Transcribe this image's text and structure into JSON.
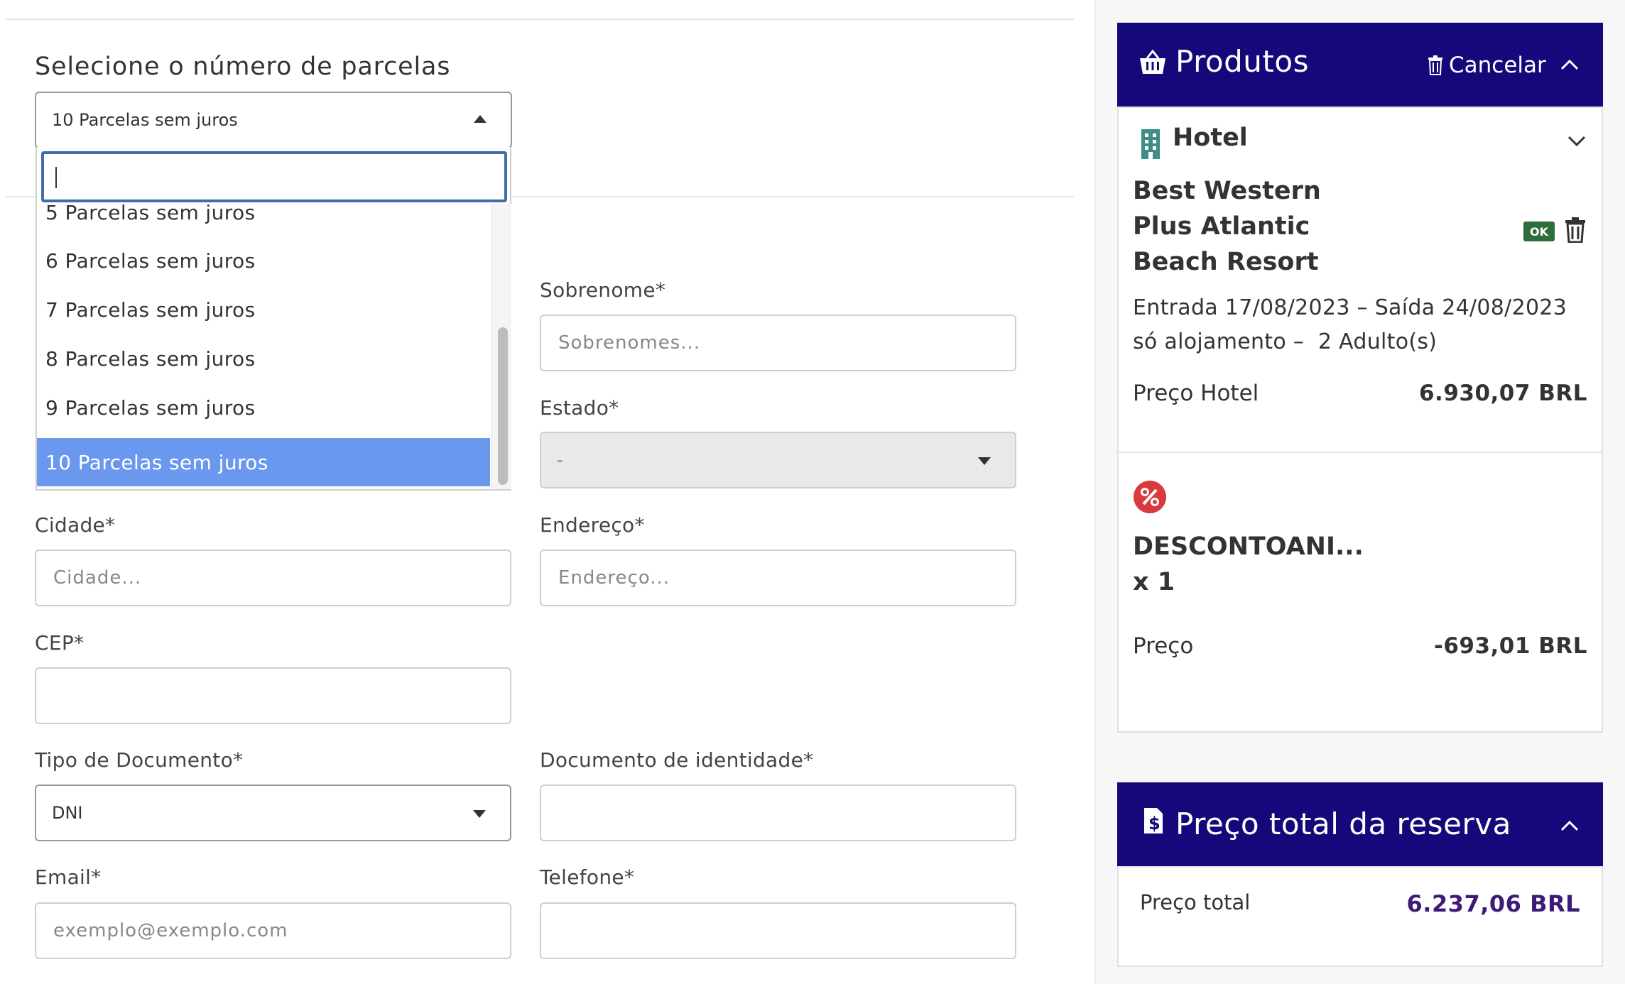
{
  "installments": {
    "label": "Selecione o número de parcelas",
    "selected": "10 Parcelas sem juros",
    "search_value": "",
    "options": [
      "5 Parcelas sem juros",
      "6 Parcelas sem juros",
      "7 Parcelas sem juros",
      "8 Parcelas sem juros",
      "9 Parcelas sem juros",
      "10 Parcelas sem juros"
    ]
  },
  "form": {
    "sobrenome": {
      "label": "Sobrenome*",
      "placeholder": "Sobrenomes..."
    },
    "estado": {
      "label": "Estado*",
      "value": "-"
    },
    "cidade": {
      "label": "Cidade*",
      "placeholder": "Cidade..."
    },
    "endereco": {
      "label": "Endereço*",
      "placeholder": "Endereço..."
    },
    "cep": {
      "label": "CEP*",
      "placeholder": ""
    },
    "tipo_documento": {
      "label": "Tipo de Documento*",
      "value": "DNI"
    },
    "documento": {
      "label": "Documento de identidade*",
      "placeholder": ""
    },
    "email": {
      "label": "Email*",
      "placeholder": "exemplo@exemplo.com"
    },
    "telefone": {
      "label": "Telefone*",
      "placeholder": ""
    }
  },
  "products": {
    "title": "Produtos",
    "cancel": "Cancelar",
    "hotel": {
      "heading": "Hotel",
      "name_lines": [
        "Best Western",
        "Plus Atlantic",
        "Beach Resort"
      ],
      "badge": "OK",
      "dates": "Entrada 17/08/2023 – Saída 24/08/2023",
      "details": "só alojamento –  2 Adulto(s)",
      "price_label": "Preço Hotel",
      "price_value": "6.930,07 BRL"
    },
    "discount": {
      "name": "DESCONTOANI...",
      "qty": "x 1",
      "price_label": "Preço",
      "price_value": "-693,01 BRL"
    }
  },
  "total": {
    "title": "Preço total da reserva",
    "label": "Preço total",
    "value": "6.237,06 BRL"
  },
  "colors": {
    "brand": "#15087a",
    "selected_option": "#6b98ef",
    "total_value": "#3d1a78",
    "hotel_icon": "#3f8c88",
    "discount_icon": "#d9393f",
    "ok_badge": "#2e6e3b"
  }
}
